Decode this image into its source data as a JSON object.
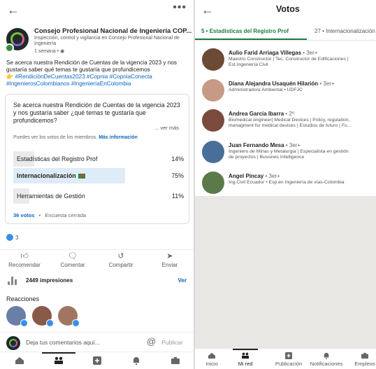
{
  "post": {
    "org_name": "Consejo Profesional Nacional de Ingeniería COP...",
    "org_desc": "Inspección, control y vigilancia en Consejo Profesional Nacional de Ingeniería",
    "time": "1 semana • ",
    "text": "Se acerca nuestra Rendición de Cuentas de la vigencia 2023 y nos gustaría saber qué temas te gustaría que profundicemos",
    "emoji": "👉",
    "hashtags": "#RendiciónDeCuentas2023 #Copnia #CopniaConecta #IngenierosColombianos #IngenieríaEnColombia"
  },
  "poll": {
    "question": "Se acerca nuestra Rendición de Cuentas de la vigencia 2023 y nos gustaría saber ¿qué temas te gustaría que profundicemos?",
    "see_more": "... ver más",
    "note": "Puedes ver los votos de los miembros.",
    "note_link": "Más información",
    "options": [
      {
        "label": "Estadísticas del Registro Prof",
        "percent": "14%",
        "value": 14,
        "selected": false
      },
      {
        "label": "Internacionalización",
        "percent": "75%",
        "value": 75,
        "selected": true
      },
      {
        "label": "Herramientas de Gestión",
        "percent": "11%",
        "value": 11,
        "selected": false
      }
    ],
    "votes": "36 votos",
    "separator": "•",
    "status": "Encuesta cerrada"
  },
  "reactions_count": "3",
  "actions": {
    "recommend": "Recomendar",
    "comment": "Comentar",
    "share": "Compartir",
    "send": "Enviar"
  },
  "impressions": {
    "text": "2449 impresiones",
    "link": "Ver"
  },
  "reactions_label": "Reacciones",
  "comment_box": {
    "placeholder": "Deja tus comentarios aquí...",
    "mention": "@",
    "publish": "Publicar"
  },
  "votes_panel": {
    "title": "Votos",
    "tabs": [
      {
        "label": "5 • Estadísticas del Registro Prof"
      },
      {
        "label": "27 • Internacionalización"
      }
    ],
    "voters": [
      {
        "name": "Aulio Farid Arriaga Villegas",
        "degree": " • 3er+",
        "sub": "Maestro Constructor | Tec. Constructor de Edificaciones |\nEst.Ingeniería Civil",
        "color": "#6b4a36"
      },
      {
        "name": "Diana Alejandra Usaquén Hilarión",
        "degree": " • 3er+",
        "sub": "Administradora Ambiental • UDFJC",
        "color": "#c79a86"
      },
      {
        "name": "Andrea Garcia Ibarra",
        "degree": " • 2º",
        "sub": "Biomedical engineer| Medical Devices | Policy, regulation,\nmanagment for medical devices | Estudios de futuro | Fo...",
        "color": "#7a4b3c"
      },
      {
        "name": "Juan Fernando Mesa",
        "degree": " • 3er+",
        "sub": "Ingeniero de Minas y Metalurgia | Especialista en gestión\nde proyectos | Bussines Intelligence",
        "color": "#4a6e9a"
      },
      {
        "name": "Angel Pincay",
        "degree": " • 3er+",
        "sub": "Ing.Civil Ecuador • Esp.en Ingeniería de vías-Colombia",
        "color": "#5a7a4a"
      }
    ],
    "nav": [
      "Inicio",
      "Mi red",
      "Publicación",
      "Notificaciones",
      "Empleos"
    ]
  }
}
